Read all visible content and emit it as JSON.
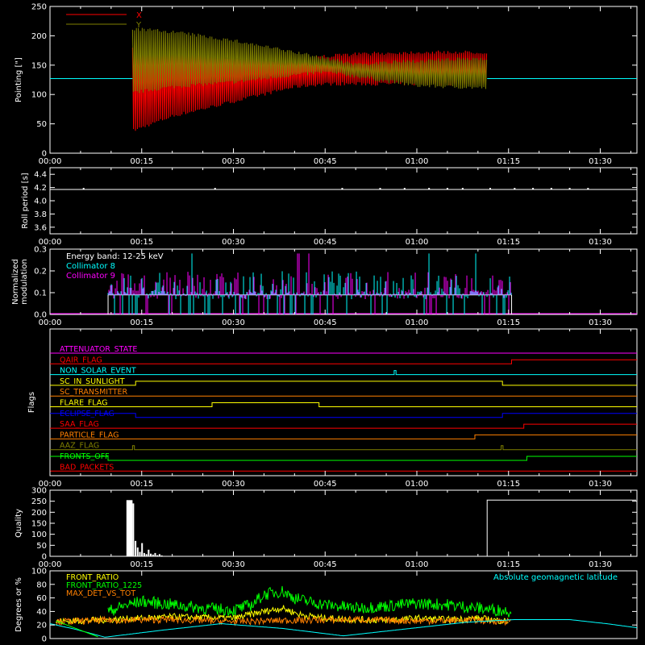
{
  "time_ticks": [
    "00:00",
    "00:15",
    "00:30",
    "00:45",
    "01:00",
    "01:15",
    "01:30"
  ],
  "chart_data": [
    {
      "type": "line",
      "panel": "pointing",
      "ylabel": "Pointing [\"]",
      "ylim": [
        0,
        250
      ],
      "y_ticks": [
        0,
        50,
        100,
        150,
        200,
        250
      ],
      "x_range_min": [
        0,
        96
      ],
      "data_span_min": [
        13.5,
        71.5
      ],
      "baseline_value": 127,
      "legend": [
        {
          "name": "X",
          "color": "#ff0000"
        },
        {
          "name": "Y",
          "color": "#808000"
        }
      ],
      "series": [
        {
          "name": "X",
          "color": "#ff0000",
          "x_min": [
            13.5,
            20,
            30,
            40,
            45,
            50,
            60,
            71.5
          ],
          "low": [
            35,
            60,
            85,
            110,
            115,
            115,
            115,
            115
          ],
          "high": [
            180,
            175,
            165,
            160,
            168,
            172,
            175,
            175
          ]
        },
        {
          "name": "Y",
          "color": "#808000",
          "x_min": [
            13.5,
            20,
            30,
            40,
            45,
            50,
            60,
            71.5
          ],
          "low": [
            100,
            110,
            118,
            130,
            135,
            128,
            112,
            108
          ],
          "high": [
            215,
            210,
            195,
            175,
            165,
            155,
            160,
            165
          ]
        }
      ]
    },
    {
      "type": "line",
      "panel": "roll_period",
      "ylabel": "Roll period [s]",
      "ylim": [
        3.5,
        4.5
      ],
      "y_ticks": [
        "3.6",
        "3.8",
        "4.0",
        "4.2",
        "4.4"
      ],
      "value": 4.17,
      "color": "#ffffff"
    },
    {
      "type": "bar",
      "panel": "modulation",
      "ylabel": "Normalized modulation",
      "ylim": [
        0,
        0.3
      ],
      "y_ticks": [
        "0.0",
        "0.1",
        "0.2",
        "0.3"
      ],
      "annotation": "Energy band: 12-25 keV",
      "data_span_min": [
        9.5,
        75.5
      ],
      "baseline_value": 0.09,
      "series": [
        {
          "name": "Collimator 8",
          "color": "#00ffff"
        },
        {
          "name": "Collimator 9",
          "color": "#ff00ff"
        }
      ]
    },
    {
      "type": "line",
      "panel": "flags",
      "ylabel": "Flags",
      "flags": [
        {
          "name": "ATTENUATOR_STATE",
          "color": "#ff00ff",
          "steps": []
        },
        {
          "name": "QAIR_FLAG",
          "color": "#ff0000",
          "steps": [
            [
              75.5,
              1
            ]
          ]
        },
        {
          "name": "NON_SOLAR_EVENT",
          "color": "#00ffff",
          "steps": [
            [
              56.3,
              1
            ],
            [
              56.6,
              0
            ]
          ]
        },
        {
          "name": "SC_IN_SUNLIGHT",
          "color": "#ffff00",
          "steps": [
            [
              14,
              1
            ],
            [
              74,
              0
            ]
          ]
        },
        {
          "name": "SC_TRANSMITTER",
          "color": "#ff8000",
          "steps": []
        },
        {
          "name": "FLARE_FLAG",
          "color": "#ffff00",
          "steps": [
            [
              26.5,
              1
            ],
            [
              44,
              0
            ]
          ]
        },
        {
          "name": "ECLIPSE_FLAG",
          "color": "#0000ff",
          "steps": [
            [
              14,
              0
            ],
            [
              74,
              1
            ]
          ]
        },
        {
          "name": "SAA_FLAG",
          "color": "#ff0000",
          "steps": [
            [
              77.5,
              1
            ]
          ]
        },
        {
          "name": "PARTICLE_FLAG",
          "color": "#ff8000",
          "steps": [
            [
              69.5,
              1
            ]
          ]
        },
        {
          "name": "AAZ_FLAG",
          "color": "#808000",
          "steps": [
            [
              13.5,
              1
            ],
            [
              13.8,
              0
            ],
            [
              73.8,
              1
            ],
            [
              74.1,
              0
            ]
          ]
        },
        {
          "name": "FRONTS_OFF",
          "color": "#00ff00",
          "steps": [
            [
              9.5,
              0
            ],
            [
              78,
              1
            ]
          ]
        },
        {
          "name": "BAD_PACKETS",
          "color": "#ff0000",
          "steps": []
        }
      ]
    },
    {
      "type": "bar",
      "panel": "quality",
      "ylabel": "Quality",
      "ylim": [
        0,
        300
      ],
      "y_ticks": [
        0,
        50,
        100,
        150,
        200,
        250,
        300
      ],
      "segments": [
        {
          "x_min": [
            9.5,
            13.5
          ],
          "value": 255
        },
        {
          "x_min": [
            71.5,
            96
          ],
          "value": 255
        }
      ],
      "bursts_x_min": [
        13.5,
        18.5
      ],
      "bursts_values": [
        240,
        70,
        40,
        20,
        60,
        15,
        10,
        30,
        12,
        8,
        15,
        5,
        10,
        4
      ]
    },
    {
      "type": "line",
      "panel": "front_ratio",
      "ylabel": "Degrees or %",
      "ylim": [
        0,
        100
      ],
      "y_ticks": [
        0,
        20,
        40,
        60,
        80,
        100
      ],
      "annotation": "Absolute geomagnetic latitude",
      "annotation_color": "#00ffff",
      "series": [
        {
          "name": "FRONT_RATIO",
          "color": "#ffff00",
          "x_min": [
            1,
            10,
            20,
            30,
            35,
            38,
            41,
            45,
            50,
            55,
            60,
            65,
            70,
            75
          ],
          "values": [
            25,
            28,
            32,
            30,
            40,
            45,
            35,
            30,
            28,
            27,
            30,
            28,
            30,
            25
          ]
        },
        {
          "name": "FRONT_RATIO_1225",
          "color": "#00ff00",
          "x_min": [
            9.5,
            12,
            15,
            20,
            25,
            30,
            33,
            35,
            38,
            40,
            42,
            45,
            50,
            55,
            60,
            65,
            70,
            75.5
          ],
          "values": [
            40,
            48,
            55,
            50,
            45,
            42,
            50,
            65,
            70,
            60,
            55,
            50,
            45,
            48,
            52,
            50,
            45,
            40
          ]
        },
        {
          "name": "MAX_DET_VS_TOT",
          "color": "#ff8000",
          "x_min": [
            1,
            10,
            20,
            30,
            40,
            50,
            60,
            70,
            75.5
          ],
          "values": [
            25,
            27,
            28,
            25,
            27,
            28,
            26,
            27,
            25
          ]
        },
        {
          "name": "Absolute geomagnetic latitude",
          "color": "#00ffff",
          "x_min": [
            0,
            4,
            9,
            18,
            28,
            38,
            48,
            58,
            68,
            76,
            85,
            91,
            96
          ],
          "values": [
            22,
            14,
            2,
            12,
            22,
            15,
            4,
            14,
            24,
            28,
            28,
            22,
            16
          ]
        },
        {
          "name": "",
          "color": "#00ff00",
          "x_min": [
            1,
            8
          ],
          "values": [
            26,
            2
          ]
        }
      ]
    }
  ]
}
